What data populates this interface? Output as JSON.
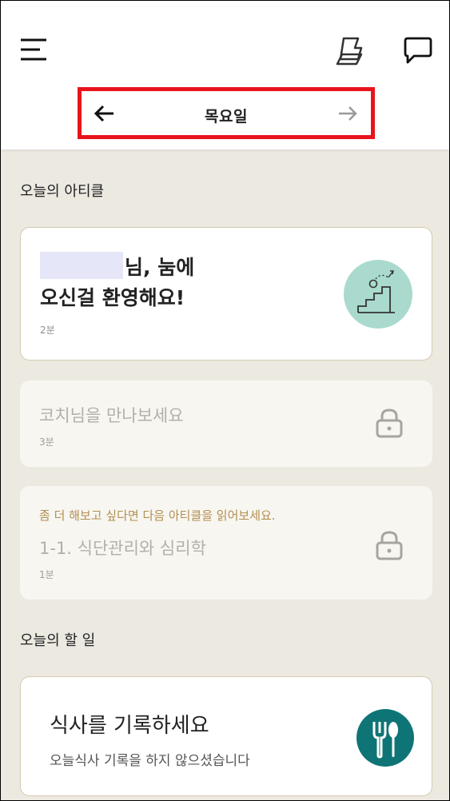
{
  "header": {
    "icons": {
      "menu": "menu-icon",
      "goal": "flag-icon",
      "chat": "chat-icon"
    }
  },
  "day_nav": {
    "label": "목요일",
    "prev_icon": "arrow-left-icon",
    "next_icon": "arrow-right-icon"
  },
  "articles": {
    "section_title": "오늘의 아티클",
    "welcome": {
      "title_line1": "님, 눔에",
      "title_line2": "오신걸 환영해요!",
      "duration": "2분"
    },
    "coach": {
      "title": "코치님을 만나보세요",
      "duration": "3분"
    },
    "psych": {
      "hint": "좀 더 해보고 싶다면 다음 아티클을 읽어보세요.",
      "title": "1-1. 식단관리와 심리학",
      "duration": "1분"
    }
  },
  "todo": {
    "section_title": "오늘의 할 일",
    "meal": {
      "title": "식사를 기록하세요",
      "subtitle": "오늘식사 기록을 하지 않으셨습니다"
    }
  },
  "colors": {
    "accent_red": "#e8141c",
    "teal": "#0f7476",
    "mint": "#a9dacd",
    "hint_gold": "#b38f50",
    "background": "#ece9e1"
  }
}
